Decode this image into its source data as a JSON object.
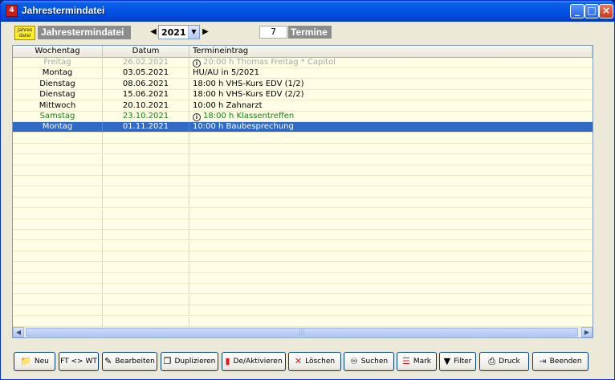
{
  "window": {
    "title": "Jahrestermindatei",
    "icon_glyph": "4",
    "controls": [
      "minimize",
      "maximize",
      "close"
    ]
  },
  "toolbar": {
    "file_icon_text": "Jahres datei",
    "doc_label": "Jahrestermindatei",
    "year": "2021",
    "count": "7",
    "count_label": "Termine"
  },
  "grid": {
    "headers": [
      "Wochentag",
      "Datum",
      "Termineintrag"
    ],
    "rows": [
      {
        "day": "Freitag",
        "date": "26.02.2021",
        "entry": "20:00 h  Thomas Freitag * Capitol",
        "info": true,
        "style": "gray"
      },
      {
        "day": "Montag",
        "date": "03.05.2021",
        "entry": "HU/AU in 5/2021",
        "info": false,
        "style": "normal"
      },
      {
        "day": "Dienstag",
        "date": "08.06.2021",
        "entry": "18:00 h VHS-Kurs EDV (1/2)",
        "info": false,
        "style": "normal"
      },
      {
        "day": "Dienstag",
        "date": "15.06.2021",
        "entry": "18:00 h VHS-Kurs EDV (2/2)",
        "info": false,
        "style": "normal"
      },
      {
        "day": "Mittwoch",
        "date": "20.10.2021",
        "entry": "10:00 h  Zahnarzt",
        "info": false,
        "style": "normal"
      },
      {
        "day": "Samstag",
        "date": "23.10.2021",
        "entry": "18:00 h Klassentreffen",
        "info": true,
        "style": "green"
      },
      {
        "day": "Montag",
        "date": "01.11.2021",
        "entry": "10:00 h Baubesprechung",
        "info": false,
        "style": "selected"
      }
    ]
  },
  "buttons": [
    {
      "label": "Neu",
      "icon": "new-icon"
    },
    {
      "label": "FT <> WT",
      "icon": ""
    },
    {
      "label": "Bearbeiten",
      "icon": "edit-icon"
    },
    {
      "label": "Duplizieren",
      "icon": "duplicate-icon"
    },
    {
      "label": "De/Aktivieren",
      "icon": "toggle-icon"
    },
    {
      "label": "Löschen",
      "icon": "delete-icon"
    },
    {
      "label": "Suchen",
      "icon": "binoculars-icon"
    },
    {
      "label": "Mark",
      "icon": "mark-icon"
    },
    {
      "label": "Filter",
      "icon": "filter-icon"
    },
    {
      "label": "Druck",
      "icon": "printer-icon"
    },
    {
      "label": "Beenden",
      "icon": "exit-icon"
    }
  ]
}
